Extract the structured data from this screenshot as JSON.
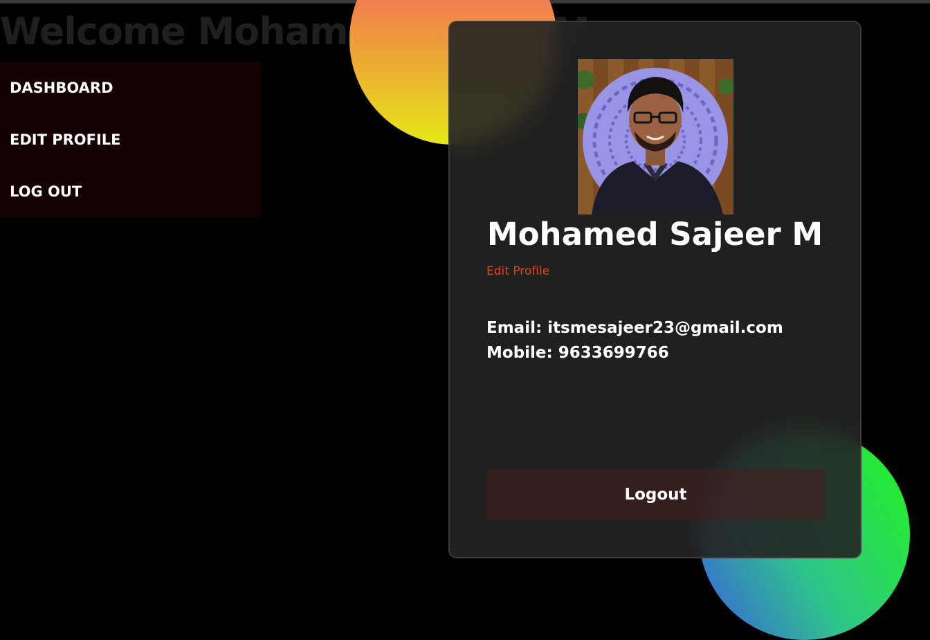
{
  "header": {
    "welcome_text": "Welcome Mohamed Sajeer M"
  },
  "sidebar": {
    "items": [
      {
        "label": "DASHBOARD"
      },
      {
        "label": "EDIT PROFILE"
      },
      {
        "label": "LOG OUT"
      }
    ]
  },
  "profile": {
    "name": "Mohamed Sajeer M",
    "edit_link": "Edit Profile",
    "email_line": "Email: itsmesajeer23@gmail.com",
    "mobile_line": "Mobile: 9633699766",
    "logout_label": "Logout"
  },
  "colors": {
    "background": "#000000",
    "sidebar_bg": "#140000",
    "card_bg": "#242424",
    "accent_link": "#e0471f",
    "blob_orange_top": "#f2507a",
    "blob_orange_bottom": "#e6e816",
    "blob_green": "#22f51a",
    "blob_blue": "#3a5de0"
  }
}
